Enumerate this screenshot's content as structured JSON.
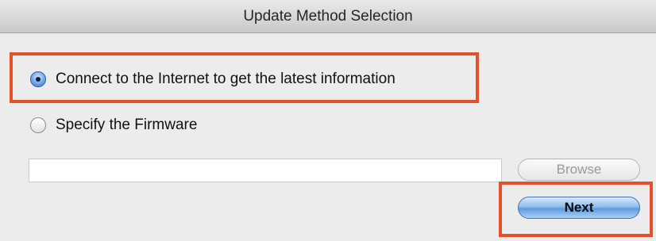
{
  "window": {
    "title": "Update Method Selection"
  },
  "options": {
    "internet": {
      "label": "Connect to the Internet to get the latest information",
      "selected": true
    },
    "firmware": {
      "label": "Specify the Firmware",
      "selected": false
    }
  },
  "firmware_path": {
    "value": "",
    "placeholder": ""
  },
  "buttons": {
    "browse": "Browse",
    "next": "Next"
  },
  "colors": {
    "highlight": "#e3502a",
    "default_button": "#5f9ae0"
  }
}
